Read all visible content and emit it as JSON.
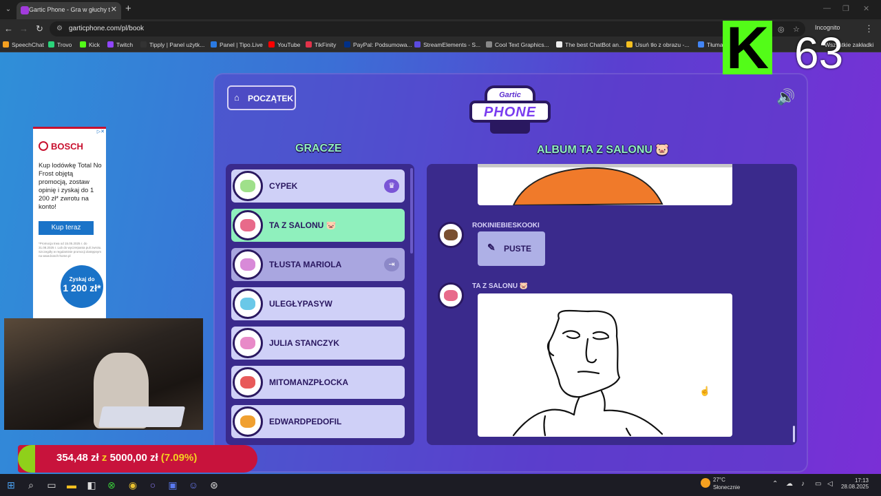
{
  "browser": {
    "tab_title": "Gartic Phone - Gra w głuchy te",
    "tab_close": "✕",
    "new_tab": "+",
    "url": "garticphone.com/pl/book",
    "incognito_label": "Incognito",
    "all_bookmarks": "Wszystkie zakładki",
    "bookmarks": [
      {
        "label": "SpeechChat",
        "color": "#f5a020"
      },
      {
        "label": "Trovo",
        "color": "#2bd47a"
      },
      {
        "label": "Kick",
        "color": "#53fc18"
      },
      {
        "label": "Twitch",
        "color": "#9146ff"
      },
      {
        "label": "Tipply | Panel użytk...",
        "color": "#333333"
      },
      {
        "label": "Panel | Tipo.Live",
        "color": "#2a7ae2"
      },
      {
        "label": "YouTube",
        "color": "#ff0000"
      },
      {
        "label": "TikFinity",
        "color": "#e2334a"
      },
      {
        "label": "PayPal: Podsumowa...",
        "color": "#003087"
      },
      {
        "label": "StreamElements - S...",
        "color": "#5b4be0"
      },
      {
        "label": "Cool Text Graphics...",
        "color": "#888888"
      },
      {
        "label": "The best ChatBot an...",
        "color": "#eeeeee"
      },
      {
        "label": "Usuń tło z obrazu -...",
        "color": "#f5c020"
      },
      {
        "label": "Tłumac",
        "color": "#4285f4"
      }
    ]
  },
  "game": {
    "home_button": "POCZĄTEK",
    "logo_top": "Gartic",
    "logo_main": "PHONE",
    "players_title": "GRACZE",
    "album_title": "ALBUM TA Z SALONU 🐷",
    "players": [
      {
        "name": "CYPEK",
        "badge": "♛",
        "state": "normal",
        "avatar_color": "#9fe08a"
      },
      {
        "name": "TA Z SALONU 🐷",
        "badge": "",
        "state": "active",
        "avatar_color": "#e86a8a"
      },
      {
        "name": "TŁUSTA MARIOLA",
        "badge": "⇥",
        "state": "dim",
        "avatar_color": "#d88ad8"
      },
      {
        "name": "ULEGŁYPASYW",
        "badge": "",
        "state": "normal",
        "avatar_color": "#6ac8e8"
      },
      {
        "name": "JULIA STANCZYK",
        "badge": "",
        "state": "normal",
        "avatar_color": "#e88ac8"
      },
      {
        "name": "MITOMANZPŁOCKA",
        "badge": "",
        "state": "normal",
        "avatar_color": "#e85a5a"
      },
      {
        "name": "EDWARDPEDOFIL",
        "badge": "",
        "state": "normal",
        "avatar_color": "#f0a030"
      }
    ],
    "album_entries": [
      {
        "author": "ROKINIEBIESKOOKI",
        "avatar_color": "#7a5030",
        "content": "PUSTE"
      },
      {
        "author": "TA Z SALONU 🐷",
        "avatar_color": "#e86a8a"
      }
    ]
  },
  "overlays": {
    "ad": {
      "brand": "BOSCH",
      "text": "Kup lodówkę Total No Frost objętą promocją, zostaw opinię i zyskaj do 1 200 zł* zwrotu na konto!",
      "cta": "Kup teraz",
      "fine_print": "*Promocja trwa od 15.05.2025 r. do 31.08.2025 r. Lub do wyczerpania puli zwrotu. Szczegóły w regulaminie promocji dostępnym na www.bosch-home.pl",
      "circle_top": "Zyskaj do",
      "circle_amount": "1 200 zł*"
    },
    "viewer_count": "63",
    "donation": {
      "current": "354,48 zł",
      "connector": "z",
      "goal": "5000,00 zł",
      "percent_text": "(7.09%)",
      "progress": 0.0709
    }
  },
  "taskbar": {
    "temperature": "27°C",
    "condition": "Słonecznie",
    "time": "17:13",
    "date": "28.08.2025",
    "notification_badge": "2"
  }
}
